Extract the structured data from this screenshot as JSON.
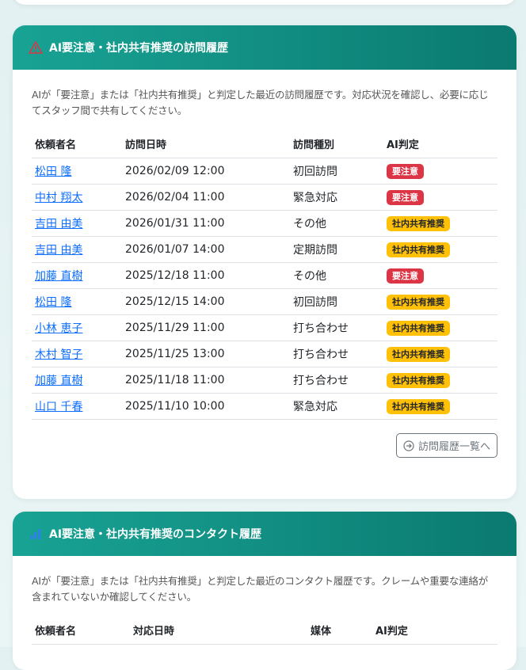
{
  "visit_card": {
    "title": "AI要注意・社内共有推奨の訪問履歴",
    "description": "AIが「要注意」または「社内共有推奨」と判定した最近の訪問履歴です。対応状況を確認し、必要に応じてスタッフ間で共有してください。",
    "columns": [
      "依頼者名",
      "訪問日時",
      "訪問種別",
      "AI判定"
    ],
    "rows": [
      {
        "name": "松田 隆",
        "datetime": "2026/02/09 12:00",
        "type": "初回訪問",
        "ai": "要注意"
      },
      {
        "name": "中村 翔太",
        "datetime": "2026/02/04 11:00",
        "type": "緊急対応",
        "ai": "要注意"
      },
      {
        "name": "吉田 由美",
        "datetime": "2026/01/31 11:00",
        "type": "その他",
        "ai": "社内共有推奨"
      },
      {
        "name": "吉田 由美",
        "datetime": "2026/01/07 14:00",
        "type": "定期訪問",
        "ai": "社内共有推奨"
      },
      {
        "name": "加藤 直樹",
        "datetime": "2025/12/18 11:00",
        "type": "その他",
        "ai": "要注意"
      },
      {
        "name": "松田 隆",
        "datetime": "2025/12/15 14:00",
        "type": "初回訪問",
        "ai": "社内共有推奨"
      },
      {
        "name": "小林 恵子",
        "datetime": "2025/11/29 11:00",
        "type": "打ち合わせ",
        "ai": "社内共有推奨"
      },
      {
        "name": "木村 智子",
        "datetime": "2025/11/25 13:00",
        "type": "打ち合わせ",
        "ai": "社内共有推奨"
      },
      {
        "name": "加藤 直樹",
        "datetime": "2025/11/18 11:00",
        "type": "打ち合わせ",
        "ai": "社内共有推奨"
      },
      {
        "name": "山口 千春",
        "datetime": "2025/11/10 10:00",
        "type": "緊急対応",
        "ai": "社内共有推奨"
      }
    ],
    "more_label": "訪問履歴一覧へ"
  },
  "contact_card": {
    "title": "AI要注意・社内共有推奨のコンタクト履歴",
    "description": "AIが「要注意」または「社内共有推奨」と判定した最近のコンタクト履歴です。クレームや重要な連絡が含まれていないか確認してください。",
    "columns": [
      "依頼者名",
      "対応日時",
      "媒体",
      "AI判定"
    ]
  },
  "colors": {
    "header_start": "#18a394",
    "header_end": "#0b7a70",
    "badge_warning": "#dc3545",
    "badge_share": "#ffc107",
    "link": "#0d6efd"
  },
  "icons": {
    "visit_card": "warning-triangle-icon",
    "contact_card": "signal-bars-icon",
    "more_button": "arrow-circle-right-icon"
  }
}
